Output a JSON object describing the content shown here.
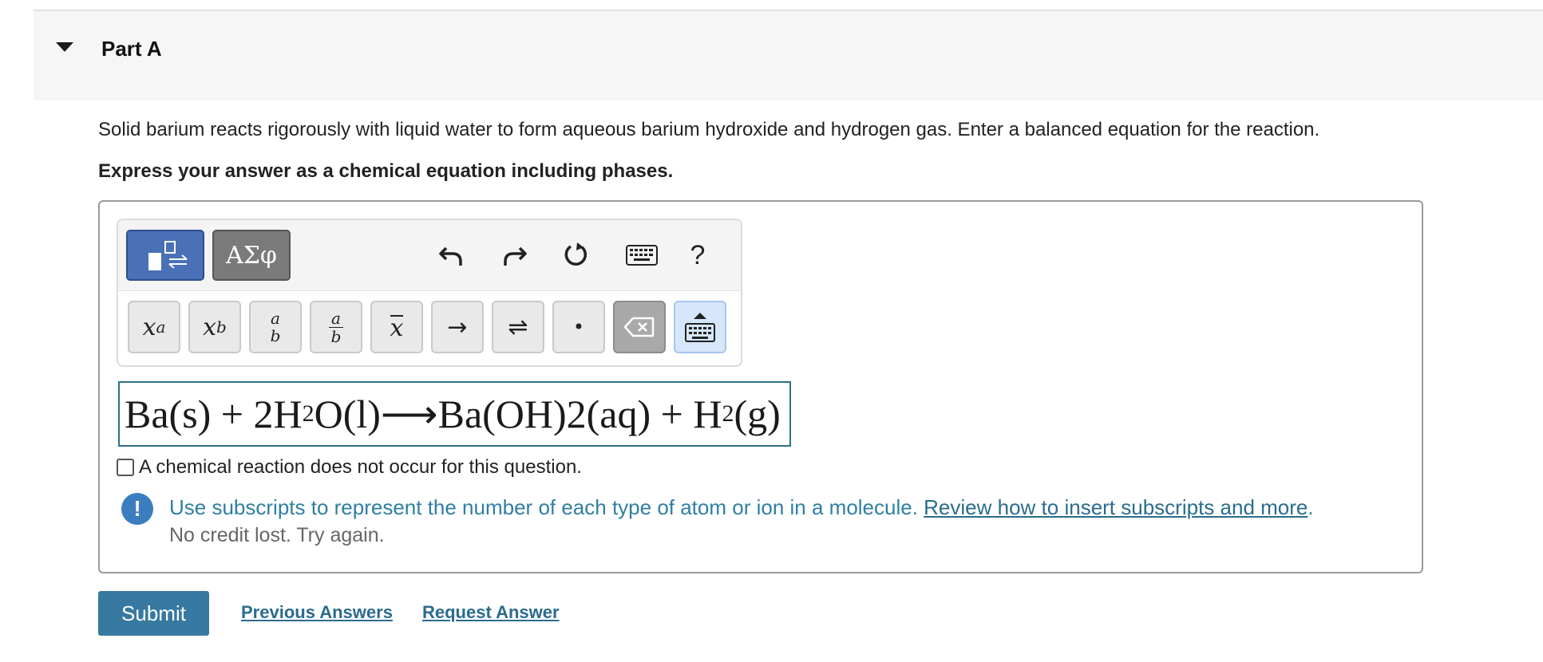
{
  "part": {
    "title": "Part A"
  },
  "question": {
    "text": "Solid barium reacts rigorously with liquid water to form aqueous barium hydroxide and hydrogen gas. Enter a balanced equation for the reaction.",
    "instruction": "Express your answer as a chemical equation including phases."
  },
  "toolbar": {
    "greek_label": "ΑΣφ",
    "help_label": "?",
    "keys": {
      "superscript_base": "x",
      "superscript_exp": "a",
      "subscript_base": "x",
      "subscript_sub": "b",
      "fraction_num": "a",
      "fraction_den": "b",
      "vector": "x",
      "arrow": "→",
      "equilibrium": "⇌",
      "dot": "•"
    }
  },
  "answer": {
    "part1": "Ba(s) + 2H",
    "sub1": "2",
    "part2": " O(l)⟶Ba(OH)2(aq) + H",
    "sub2": "2",
    "part3": " (g)"
  },
  "no_reaction_label": "A chemical reaction does not occur for this question.",
  "feedback": {
    "icon_glyph": "!",
    "message": "Use subscripts to represent the number of each type of atom or ion in a molecule. ",
    "link_text": "Review how to insert subscripts and more",
    "message_end": ".",
    "sub_message": "No credit lost. Try again."
  },
  "actions": {
    "submit": "Submit",
    "previous_answers": "Previous Answers",
    "request_answer": "Request Answer"
  },
  "colors": {
    "accent": "#3779a0",
    "feedback": "#2f7fa3",
    "template_btn": "#4a70b8"
  }
}
